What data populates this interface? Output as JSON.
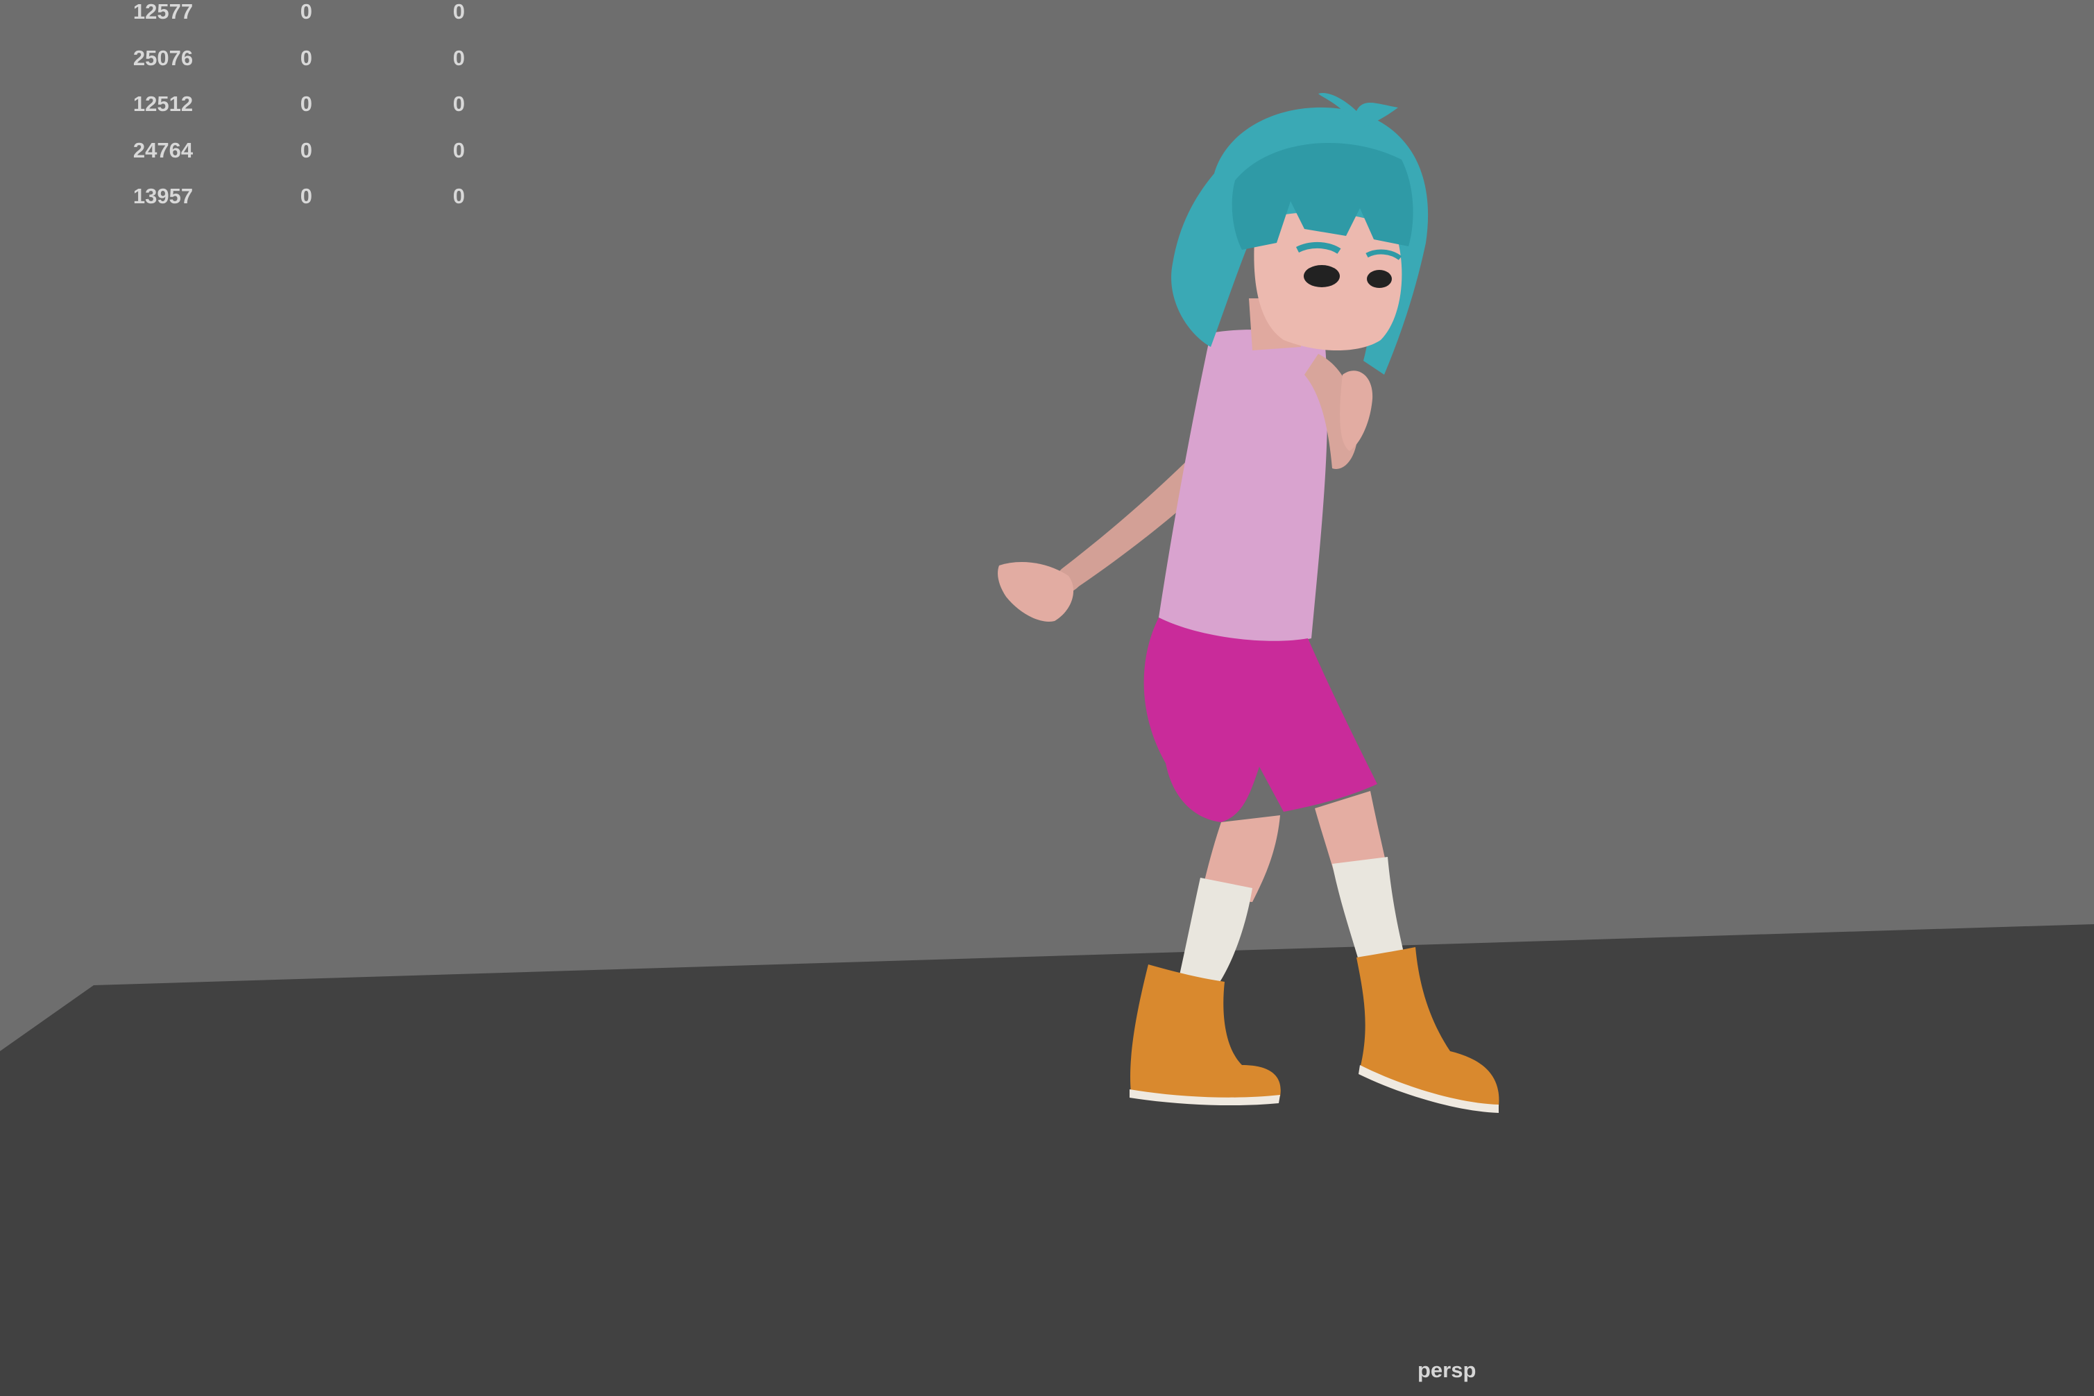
{
  "hud": {
    "rows": [
      {
        "a": "12577",
        "b": "0",
        "c": "0"
      },
      {
        "a": "25076",
        "b": "0",
        "c": "0"
      },
      {
        "a": "12512",
        "b": "0",
        "c": "0"
      },
      {
        "a": "24764",
        "b": "0",
        "c": "0"
      },
      {
        "a": "13957",
        "b": "0",
        "c": "0"
      }
    ]
  },
  "camera": {
    "label": "persp"
  },
  "colors": {
    "background": "#6e6e6e",
    "floor": "#414141",
    "hair": "#3aa9b5",
    "shirt": "#d9a3cf",
    "shorts": "#c92b9a",
    "skin": "#e8b4aa",
    "socks": "#e9e6de",
    "boots": "#d9892e"
  }
}
